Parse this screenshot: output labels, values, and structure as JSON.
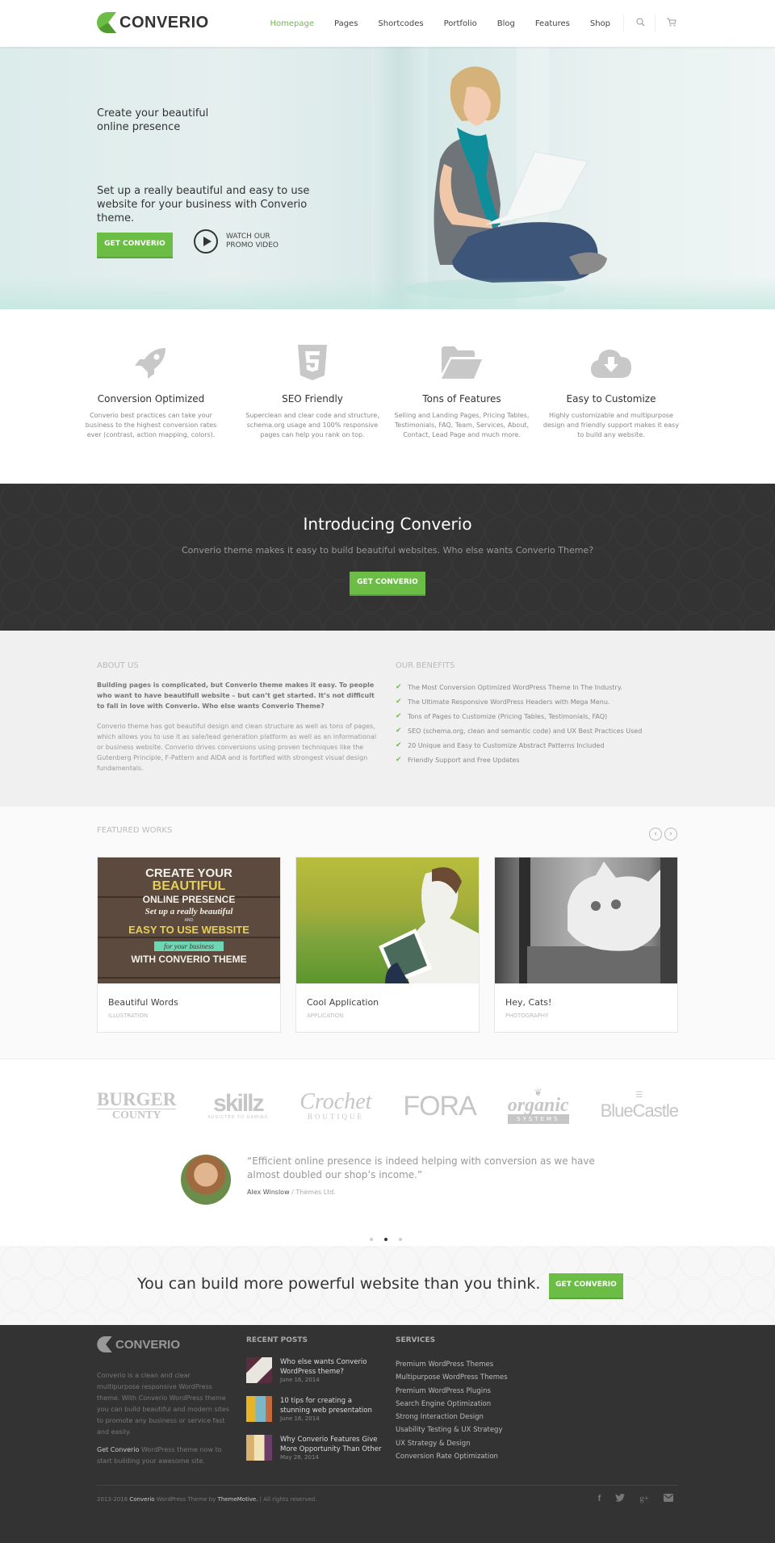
{
  "brand": {
    "name": "CONVERIO",
    "accent": "#6cbd45"
  },
  "nav": {
    "items": [
      "Homepage",
      "Pages",
      "Shortcodes",
      "Portfolio",
      "Blog",
      "Features",
      "Shop"
    ],
    "active": "Homepage",
    "icons": [
      "search-icon",
      "cart-icon"
    ]
  },
  "hero": {
    "tagline": "Create your beautiful online presence",
    "subtitle": "Set up a really beautiful and easy to use website for your business with Converio theme.",
    "cta_label": "GET CONVERIO",
    "promo_label": "WATCH OUR PROMO VIDEO"
  },
  "features": [
    {
      "icon": "rocket-icon",
      "title": "Conversion Optimized",
      "text": "Converio best practices can take your business to the highest conversion rates ever (contrast, action mapping, colors)."
    },
    {
      "icon": "html5-icon",
      "title": "SEO Friendly",
      "text": "Superclean and clear code and structure, schema.org usage and 100% responsive pages can help you rank on top."
    },
    {
      "icon": "folder-open-icon",
      "title": "Tons of Features",
      "text": "Selling and Landing Pages, Pricing Tables, Testimonials, FAQ, Team, Services, About, Contact, Lead Page and much more."
    },
    {
      "icon": "cloud-download-icon",
      "title": "Easy to Customize",
      "text": "Highly customizable and multipurpose design and friendly support makes it easy to build any website."
    }
  ],
  "intro": {
    "title": "Introducing Converio",
    "text": "Converio theme makes it easy to build beautiful websites. Who else wants Converio Theme?",
    "cta_label": "GET CONVERIO"
  },
  "about": {
    "heading": "ABOUT US",
    "bold": "Building pages is complicated, but Converio theme makes it easy. To people who want to have beautifull website – but can’t get started. It’s not difficult to fall in love with Converio. Who else wants Converio Theme?",
    "text": "Converio theme has got beautiful design and clean structure as well as tons of pages, which allows you to use it as sale/lead generation platform as well as an informational or business website. Converio drives conversions using proven techniques like the Gutenberg Principle, F-Pattern and AIDA and is fortified with strongest visual design fundamentals."
  },
  "benefits": {
    "heading": "OUR BENEFITS",
    "items": [
      "The Most Conversion Optimized WordPress Theme In The Industry.",
      "The Ultimate Responsive WordPress Headers with Mega Menu.",
      "Tons of Pages to Customize (Pricing Tables, Testimonials, FAQ)",
      "SEO (schema.org, clean and semantic code) and UX Best Practices Used",
      "20 Unique and Easy to Customize Abstract Patterns Included",
      "Friendly Support and Free Updates"
    ]
  },
  "works": {
    "heading": "FEATURED WORKS",
    "items": [
      {
        "title": "Beautiful Words",
        "category": "ILLUSTRATION",
        "poster": {
          "l1": "CREATE YOUR",
          "l2": "BEAUTIFUL",
          "l3": "ONLINE PRESENCE",
          "l4": "Set up a really beautiful",
          "l5": "AND",
          "l6": "EASY TO USE WEBSITE",
          "l7": "for your business",
          "l8": "WITH CONVERIO THEME"
        }
      },
      {
        "title": "Cool Application",
        "category": "APPLICATION"
      },
      {
        "title": "Hey, Cats!",
        "category": "PHOTOGRAPHY"
      }
    ]
  },
  "clients": [
    {
      "name": "BURGER",
      "sub": "COUNTY"
    },
    {
      "name": "skillz",
      "sub": "ADDICTED TO GAMING"
    },
    {
      "name": "Crochet",
      "sub": "BOUTIQUE"
    },
    {
      "name": "FORA",
      "sub": ""
    },
    {
      "name": "organic",
      "sub": "SYSTEMS"
    },
    {
      "name": "BlueCastle",
      "sub": ""
    }
  ],
  "testimonial": {
    "quote": "“Efficient online presence is indeed helping with conversion as we have almost doubled our shop’s income.”",
    "author": "Alex Winslow",
    "company": " / Themes Ltd.",
    "active_dot": 2,
    "dot_count": 3
  },
  "cta": {
    "text": "You can build more powerful website than you think.",
    "button": "GET CONVERIO"
  },
  "footer": {
    "brand": "CONVERIO",
    "about": "Converio is a clean and clear multipurpose responsive WordPress theme. With Converio WordPress theme you can build beautiful and modern sites to promote any business or service fast and easily.",
    "about2_link": "Get Converio",
    "about2_rest": " WordPress theme now to start building your awesome site.",
    "posts_heading": "RECENT POSTS",
    "posts": [
      {
        "title": "Who else wants Converio WordPress theme?",
        "date": "June 16, 2014"
      },
      {
        "title": "10 tips for creating a stunning web presentation",
        "date": "June 16, 2014"
      },
      {
        "title": "Why Converio Features Give More Opportunity Than Other",
        "date": "May 28, 2014"
      }
    ],
    "services_heading": "SERVICES",
    "services": [
      "Premium WordPress Themes",
      "Multipurpose WordPress Themes",
      "Premium WordPress Plugins",
      "Search Engine Optimization",
      "Strong Interaction Design",
      "Usability Testing & UX Strategy",
      "UX Strategy & Design",
      "Conversion Rate Optimization"
    ],
    "copy_pre": "2013-2016 ",
    "copy_brand": "Converio",
    "copy_mid": " WordPress Theme by ",
    "copy_author": "ThemeMotive.",
    "copy_post": " | All rights reserved.",
    "social": [
      "facebook-icon",
      "twitter-icon",
      "google-plus-icon",
      "email-icon"
    ]
  }
}
